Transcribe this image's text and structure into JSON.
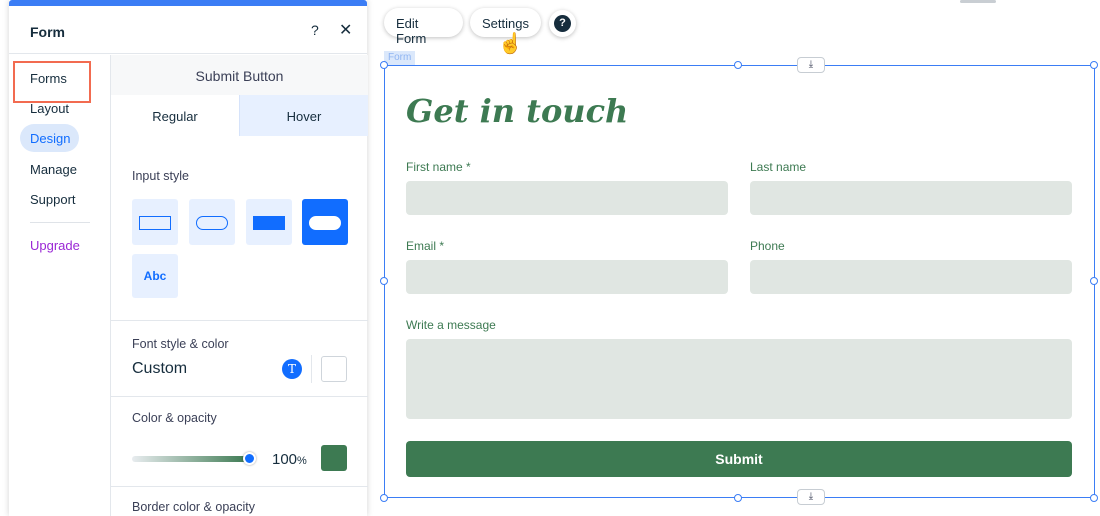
{
  "panel": {
    "title": "Form",
    "help_label": "?",
    "close_label": "✕",
    "accent_color": "#116dff"
  },
  "nav": {
    "items": [
      {
        "label": "Forms"
      },
      {
        "label": "Layout"
      },
      {
        "label": "Design",
        "active": true
      },
      {
        "label": "Manage"
      },
      {
        "label": "Support"
      }
    ],
    "upgrade_label": "Upgrade"
  },
  "design": {
    "section_title": "Submit Button",
    "tabs": [
      {
        "label": "Regular",
        "selected": true
      },
      {
        "label": "Hover",
        "selected": false
      }
    ],
    "input_style_label": "Input style",
    "input_styles": [
      "rectangle-outline",
      "rounded-outline",
      "rectangle-filled",
      "rounded-filled",
      "text-only"
    ],
    "input_style_selected": "rounded-filled",
    "text_style_sample": "Abc",
    "font_style_label": "Font style & color",
    "font_style_value": "Custom",
    "font_icon_glyph": "T",
    "font_color": "#ffffff",
    "color_opacity_label": "Color & opacity",
    "opacity_value": "100",
    "opacity_unit": "%",
    "fill_color": "#3d7a52",
    "border_label": "Border color & opacity"
  },
  "toolbar": {
    "edit_form": "Edit Form",
    "settings": "Settings",
    "help_glyph": "?"
  },
  "form": {
    "tag_label": "Form",
    "heading": "Get in touch",
    "fields": {
      "first_name": "First name *",
      "last_name": "Last name",
      "email": "Email *",
      "phone": "Phone",
      "message": "Write a message"
    },
    "submit_label": "Submit",
    "field_color": "#e0e6e2",
    "brand_color": "#3d7a52"
  }
}
